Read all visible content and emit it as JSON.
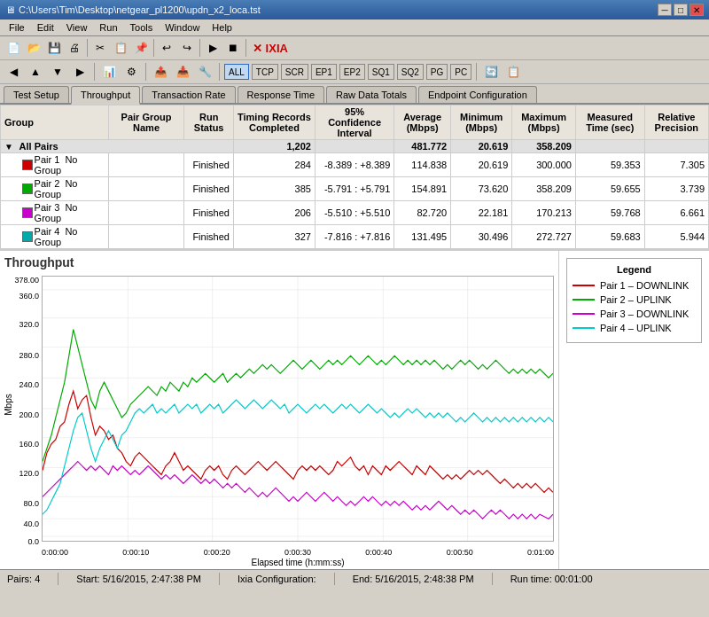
{
  "titlebar": {
    "title": "C:\\Users\\Tim\\Desktop\\netgear_pl1200\\updn_x2_loca.tst",
    "min": "─",
    "max": "□",
    "close": "✕"
  },
  "menu": {
    "items": [
      "File",
      "Edit",
      "View",
      "Run",
      "Tools",
      "Window",
      "Help"
    ]
  },
  "filters": {
    "all": "ALL",
    "items": [
      "TCP",
      "SCR",
      "EP1",
      "EP2",
      "SQ1",
      "SQ2",
      "PG",
      "PC"
    ]
  },
  "tabs": {
    "items": [
      "Test Setup",
      "Throughput",
      "Transaction Rate",
      "Response Time",
      "Raw Data Totals",
      "Endpoint Configuration"
    ],
    "active": 1
  },
  "table": {
    "headers": [
      "Group",
      "Pair Group Name",
      "Run Status",
      "Timing Records Completed",
      "95% Confidence Interval",
      "Average (Mbps)",
      "Minimum (Mbps)",
      "Maximum (Mbps)",
      "Measured Time (sec)",
      "Relative Precision"
    ],
    "allpairs": {
      "label": "All Pairs",
      "records": "1,202",
      "average": "481.772",
      "minimum": "20.619",
      "maximum": "358.209"
    },
    "rows": [
      {
        "id": 1,
        "color": "#cc0000",
        "name": "Pair 1",
        "group": "No Group",
        "status": "Finished",
        "records": "284",
        "ci": "-8.389 : +8.389",
        "average": "114.838",
        "min": "20.619",
        "max": "300.000",
        "time": "59.353",
        "rp": "7.305"
      },
      {
        "id": 2,
        "color": "#00aa00",
        "name": "Pair 2",
        "group": "No Group",
        "status": "Finished",
        "records": "385",
        "ci": "-5.791 : +5.791",
        "average": "154.891",
        "min": "73.620",
        "max": "358.209",
        "time": "59.655",
        "rp": "3.739"
      },
      {
        "id": 3,
        "color": "#cc00cc",
        "name": "Pair 3",
        "group": "No Group",
        "status": "Finished",
        "records": "206",
        "ci": "-5.510 : +5.510",
        "average": "82.720",
        "min": "22.181",
        "max": "170.213",
        "time": "59.768",
        "rp": "6.661"
      },
      {
        "id": 4,
        "color": "#00aaaa",
        "name": "Pair 4",
        "group": "No Group",
        "status": "Finished",
        "records": "327",
        "ci": "-7.816 : +7.816",
        "average": "131.495",
        "min": "30.496",
        "max": "272.727",
        "time": "59.683",
        "rp": "5.944"
      }
    ]
  },
  "chart": {
    "title": "Throughput",
    "y_label": "Mbps",
    "x_label": "Elapsed time (h:mm:ss)",
    "y_ticks": [
      "378.00",
      "360.0",
      "320.0",
      "280.0",
      "240.0",
      "200.0",
      "160.0",
      "120.0",
      "80.0",
      "40.0",
      "0.0"
    ],
    "x_ticks": [
      "0:00:00",
      "0:00:10",
      "0:00:20",
      "0:00:30",
      "0:00:40",
      "0:00:50",
      "0:01:00"
    ],
    "legend": {
      "title": "Legend",
      "items": [
        {
          "label": "Pair 1 – DOWNLINK",
          "color": "#cc0000"
        },
        {
          "label": "Pair 2 – UPLINK",
          "color": "#00aa00"
        },
        {
          "label": "Pair 3 – DOWNLINK",
          "color": "#cc00cc"
        },
        {
          "label": "Pair 4 – UPLINK",
          "color": "#00cccc"
        }
      ]
    }
  },
  "statusbar": {
    "pairs": "Pairs: 4",
    "start": "Start: 5/16/2015, 2:47:38 PM",
    "ixia": "Ixia Configuration:",
    "end": "End: 5/16/2015, 2:48:38 PM",
    "runtime": "Run time: 00:01:00"
  }
}
